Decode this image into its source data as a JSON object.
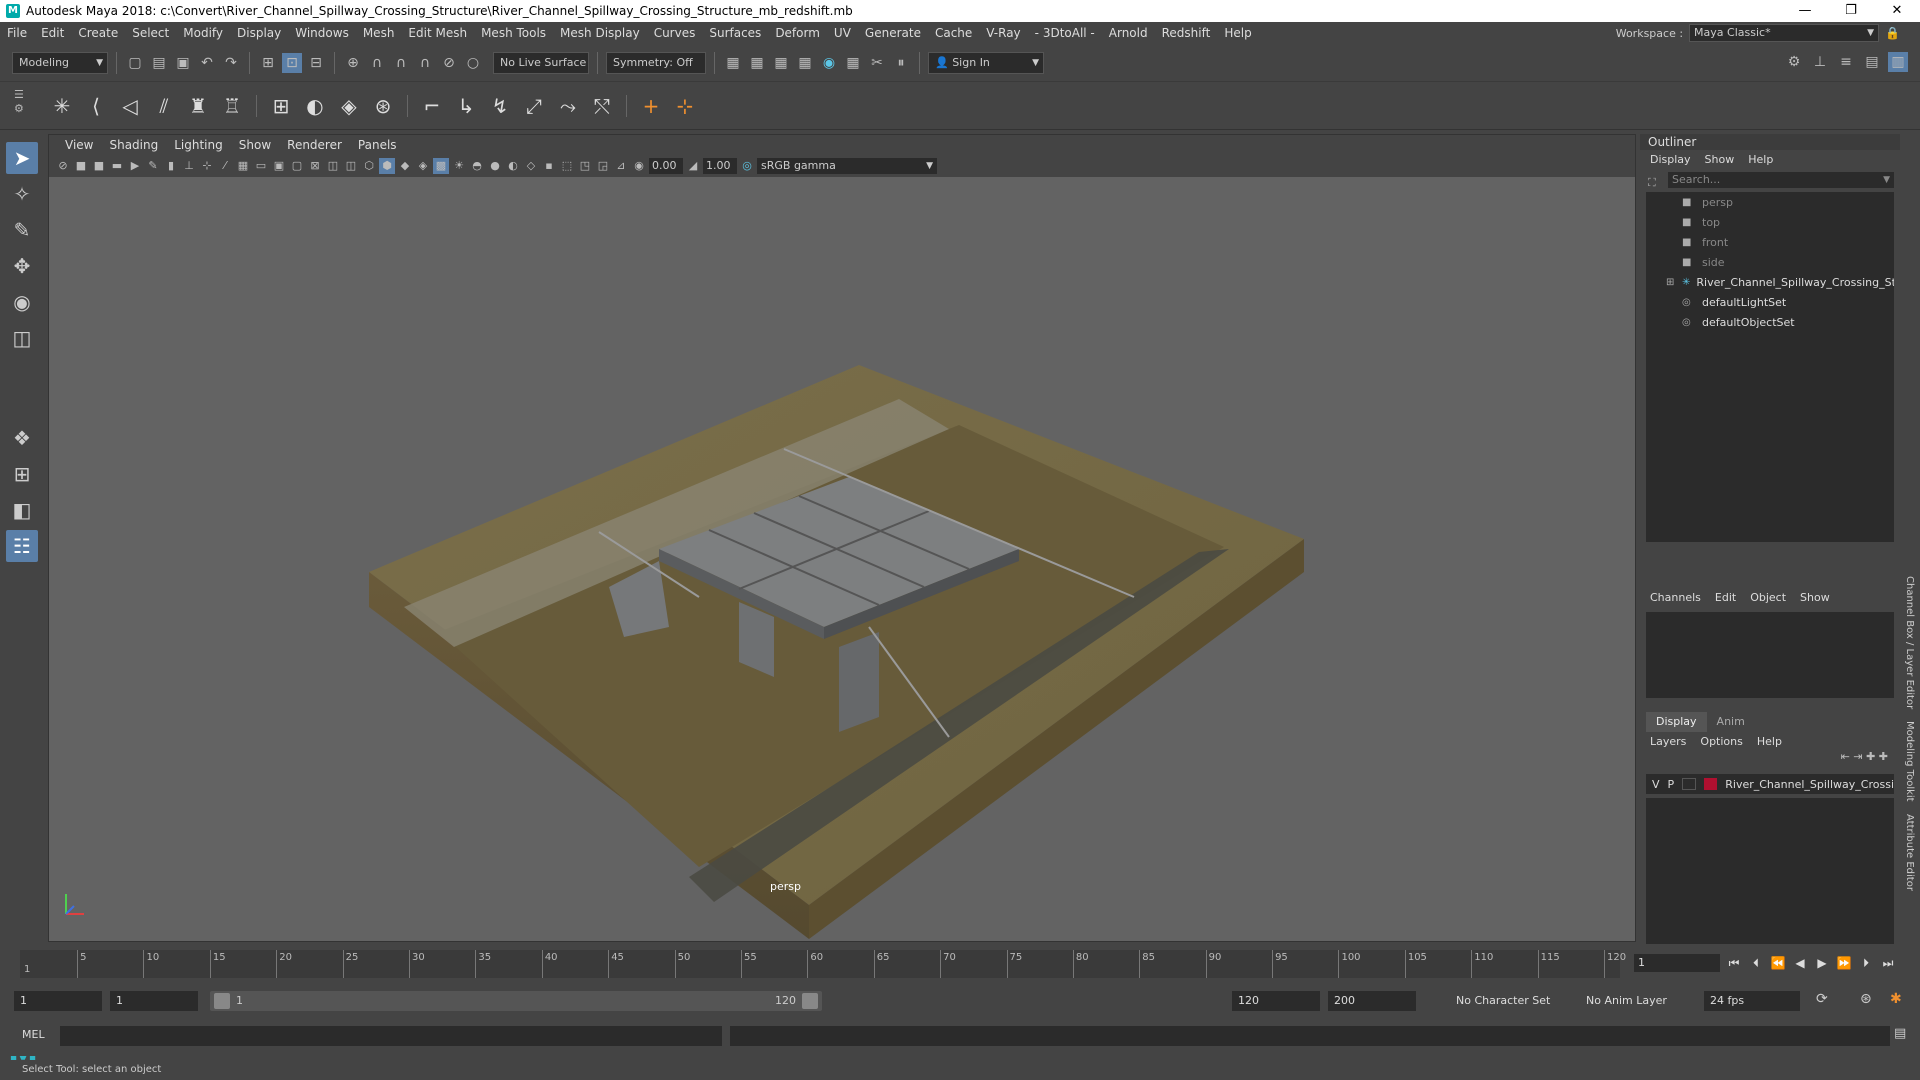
{
  "window": {
    "title": "Autodesk Maya 2018: c:\\Convert\\River_Channel_Spillway_Crossing_Structure\\River_Channel_Spillway_Crossing_Structure_mb_redshift.mb",
    "minimize": "—",
    "maximize": "❐",
    "close": "✕"
  },
  "menus": [
    "File",
    "Edit",
    "Create",
    "Select",
    "Modify",
    "Display",
    "Windows",
    "Mesh",
    "Edit Mesh",
    "Mesh Tools",
    "Mesh Display",
    "Curves",
    "Surfaces",
    "Deform",
    "UV",
    "Generate",
    "Cache",
    "V-Ray",
    "- 3DtoAll -",
    "Arnold",
    "Redshift",
    "Help"
  ],
  "workspace": {
    "label": "Workspace :",
    "value": "Maya Classic*"
  },
  "status": {
    "mode": "Modeling",
    "live_surface": "No Live Surface",
    "symmetry": "Symmetry: Off",
    "sign_in": "Sign In"
  },
  "viewport": {
    "menus": [
      "View",
      "Shading",
      "Lighting",
      "Show",
      "Renderer",
      "Panels"
    ],
    "exposure": "0.00",
    "gamma_value": "1.00",
    "color_space": "sRGB gamma",
    "camera": "persp"
  },
  "outliner": {
    "title": "Outliner",
    "menus": [
      "Display",
      "Show",
      "Help"
    ],
    "search_placeholder": "Search...",
    "items": [
      {
        "label": "persp",
        "icon": "camera-icon",
        "dim": true
      },
      {
        "label": "top",
        "icon": "camera-icon",
        "dim": true
      },
      {
        "label": "front",
        "icon": "camera-icon",
        "dim": true
      },
      {
        "label": "side",
        "icon": "camera-icon",
        "dim": true
      },
      {
        "label": "River_Channel_Spillway_Crossing_Struct",
        "icon": "group-icon",
        "dim": false
      },
      {
        "label": "defaultLightSet",
        "icon": "set-icon",
        "dim": false
      },
      {
        "label": "defaultObjectSet",
        "icon": "set-icon",
        "dim": false
      }
    ]
  },
  "channelbox": {
    "menus": [
      "Channels",
      "Edit",
      "Object",
      "Show"
    ]
  },
  "layers": {
    "tabs": [
      "Display",
      "Anim"
    ],
    "menus": [
      "Layers",
      "Options",
      "Help"
    ],
    "layer_v": "V",
    "layer_p": "P",
    "layer_name": "River_Channel_Spillway_Crossi"
  },
  "side_tabs": [
    "Channel Box / Layer Editor",
    "Modeling Toolkit",
    "Attribute Editor"
  ],
  "timeline": {
    "ticks": [
      "5",
      "10",
      "15",
      "20",
      "25",
      "30",
      "35",
      "40",
      "45",
      "50",
      "55",
      "60",
      "65",
      "70",
      "75",
      "80",
      "85",
      "90",
      "95",
      "100",
      "105",
      "110",
      "115",
      "120"
    ],
    "start_label": "1",
    "current_frame": "1"
  },
  "range": {
    "start": "1",
    "playback_start": "1",
    "slider_start": "1",
    "slider_end": "120",
    "playback_end": "120",
    "end": "200",
    "character_set": "No Character Set",
    "anim_layer": "No Anim Layer",
    "fps": "24 fps"
  },
  "cmd": {
    "label": "MEL"
  },
  "help": {
    "text": "Select Tool: select an object"
  }
}
